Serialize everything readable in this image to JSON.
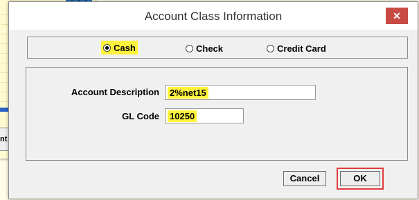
{
  "background_window": {
    "partial_label": "nt"
  },
  "dialog": {
    "title": "Account Class Information",
    "close_glyph": "✕"
  },
  "account_type": {
    "options": [
      {
        "label": "Cash",
        "selected": true
      },
      {
        "label": "Check",
        "selected": false
      },
      {
        "label": "Credit Card",
        "selected": false
      }
    ]
  },
  "fields": {
    "account_description": {
      "label": "Account Description",
      "value": "2%net15"
    },
    "gl_code": {
      "label": "GL Code",
      "value": "10250"
    }
  },
  "buttons": {
    "cancel_label": "Cancel",
    "ok_label": "OK"
  },
  "colors": {
    "highlight": "#fff23c",
    "close_button": "#c74a44",
    "ok_outline": "#e03b3b",
    "dialog_bg": "#f0f0f0"
  }
}
